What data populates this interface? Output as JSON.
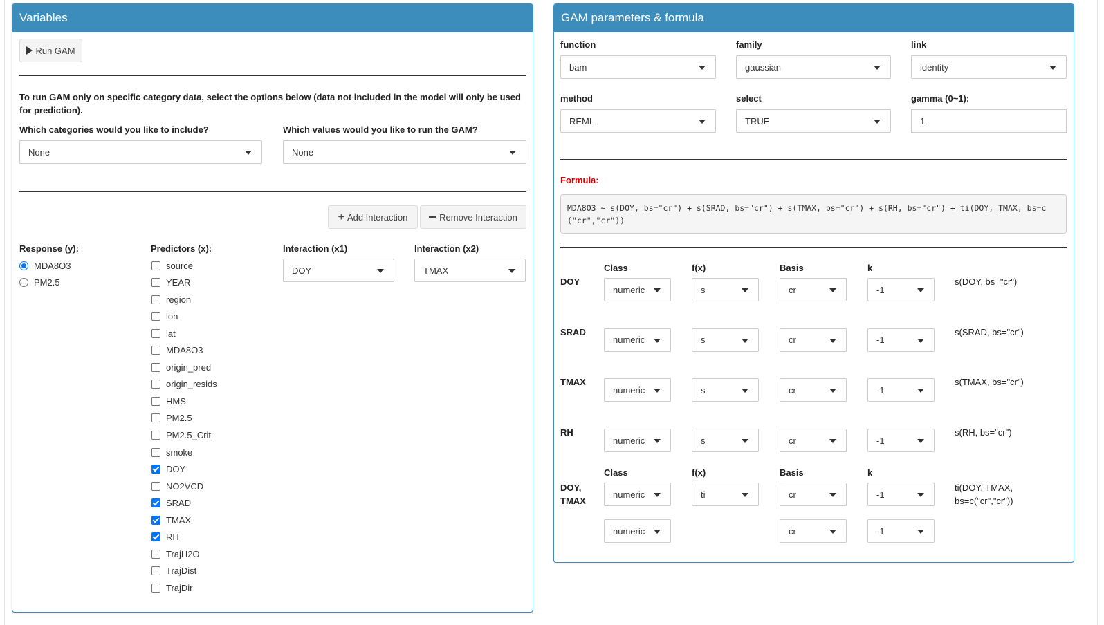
{
  "variables_panel": {
    "title": "Variables",
    "run_button": "Run GAM",
    "category_info": "To run GAM only on specific category data, select the options below (data not included in the model will only be used for prediction).",
    "categories_label": "Which categories would you like to include?",
    "categories_value": "None",
    "values_label": "Which values would you like to run the GAM?",
    "values_value": "None",
    "add_interaction": "Add Interaction",
    "remove_interaction": "Remove Interaction",
    "response_label": "Response (y):",
    "response_options": [
      {
        "label": "MDA8O3",
        "selected": true
      },
      {
        "label": "PM2.5",
        "selected": false
      }
    ],
    "predictors_label": "Predictors (x):",
    "predictors": [
      {
        "label": "source",
        "checked": false
      },
      {
        "label": "YEAR",
        "checked": false
      },
      {
        "label": "region",
        "checked": false
      },
      {
        "label": "lon",
        "checked": false
      },
      {
        "label": "lat",
        "checked": false
      },
      {
        "label": "MDA8O3",
        "checked": false
      },
      {
        "label": "origin_pred",
        "checked": false
      },
      {
        "label": "origin_resids",
        "checked": false
      },
      {
        "label": "HMS",
        "checked": false
      },
      {
        "label": "PM2.5",
        "checked": false
      },
      {
        "label": "PM2.5_Crit",
        "checked": false
      },
      {
        "label": "smoke",
        "checked": false
      },
      {
        "label": "DOY",
        "checked": true
      },
      {
        "label": "NO2VCD",
        "checked": false
      },
      {
        "label": "SRAD",
        "checked": true
      },
      {
        "label": "TMAX",
        "checked": true
      },
      {
        "label": "RH",
        "checked": true
      },
      {
        "label": "TrajH2O",
        "checked": false
      },
      {
        "label": "TrajDist",
        "checked": false
      },
      {
        "label": "TrajDir",
        "checked": false
      }
    ],
    "interaction_x1_label": "Interaction (x1)",
    "interaction_x1_value": "DOY",
    "interaction_x2_label": "Interaction (x2)",
    "interaction_x2_value": "TMAX"
  },
  "gam_panel": {
    "title": "GAM parameters & formula",
    "function_label": "function",
    "function_value": "bam",
    "family_label": "family",
    "family_value": "gaussian",
    "link_label": "link",
    "link_value": "identity",
    "method_label": "method",
    "method_value": "REML",
    "select_label": "select",
    "select_value": "TRUE",
    "gamma_label": "gamma (0~1):",
    "gamma_value": "1",
    "formula_label": "Formula:",
    "formula_line1": "MDA8O3 ~ s(DOY, bs=\"cr\") + s(SRAD, bs=\"cr\") + s(TMAX, bs=\"cr\") + s(RH, bs=\"cr\") + ti(DOY, TMAX, bs=c",
    "formula_line2": "(\"cr\",\"cr\"))",
    "col_class": "Class",
    "col_fx": "f(x)",
    "col_basis": "Basis",
    "col_k": "k",
    "terms": [
      {
        "name": "DOY",
        "class": "numeric",
        "fx": "s",
        "basis": "cr",
        "k": "-1",
        "term": "s(DOY, bs=\"cr\")"
      },
      {
        "name": "SRAD",
        "class": "numeric",
        "fx": "s",
        "basis": "cr",
        "k": "-1",
        "term": "s(SRAD, bs=\"cr\")"
      },
      {
        "name": "TMAX",
        "class": "numeric",
        "fx": "s",
        "basis": "cr",
        "k": "-1",
        "term": "s(TMAX, bs=\"cr\")"
      },
      {
        "name": "RH",
        "class": "numeric",
        "fx": "s",
        "basis": "cr",
        "k": "-1",
        "term": "s(RH, bs=\"cr\")"
      }
    ],
    "interaction": {
      "name_line1": "DOY,",
      "name_line2": "TMAX",
      "class1": "numeric",
      "fx": "ti",
      "basis1": "cr",
      "k1": "-1",
      "class2": "numeric",
      "basis2": "cr",
      "k2": "-1",
      "term_line1": "ti(DOY, TMAX,",
      "term_line2": "bs=c(\"cr\",\"cr\"))"
    }
  },
  "colors": {
    "header": "#3c8dbc",
    "formula_label": "#dd0000",
    "checkbox": "#0075ff"
  }
}
